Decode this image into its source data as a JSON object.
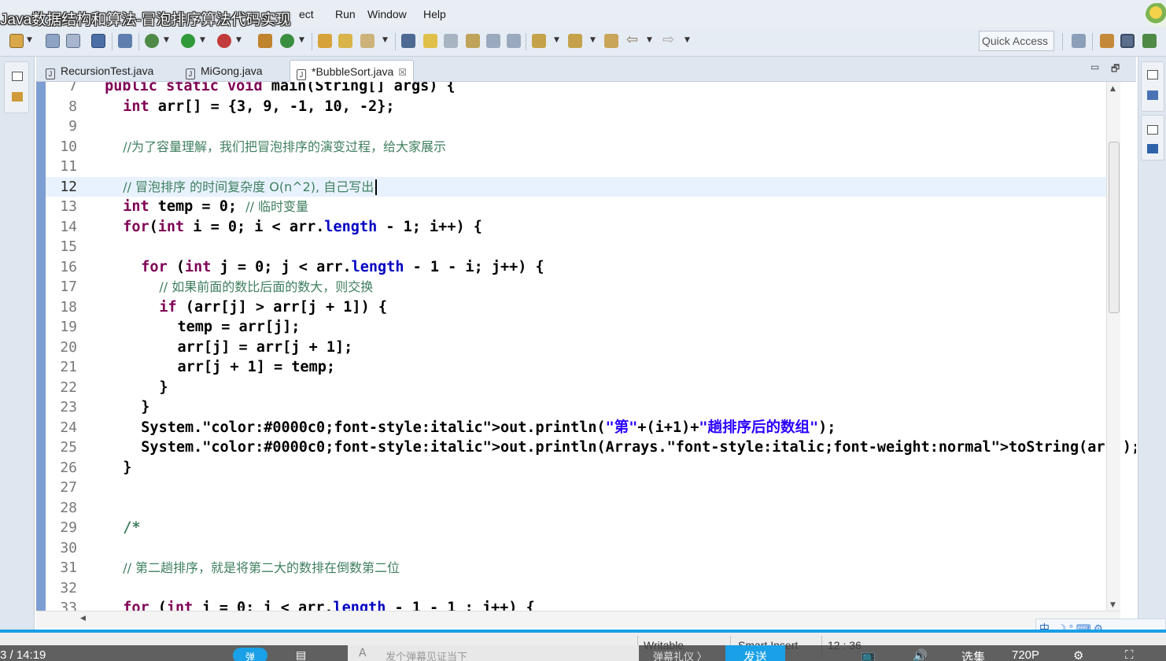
{
  "window": {
    "video_title": "Java数据结构和算法-冒泡排序算法代码实现",
    "menus": [
      "ect",
      "Run",
      "Window",
      "Help"
    ]
  },
  "toolbar": {
    "quick_access": "Quick Access"
  },
  "tabs": [
    {
      "label": "RecursionTest.java",
      "active": false
    },
    {
      "label": "MiGong.java",
      "active": false
    },
    {
      "label": "*BubbleSort.java",
      "active": true,
      "close": "☒"
    }
  ],
  "editor": {
    "current_line": "12",
    "lines": [
      {
        "n": "7",
        "text": "    public static void main(String[] args) {"
      },
      {
        "n": "8",
        "text": "        int arr[] = {3, 9, -1, 10, -2};"
      },
      {
        "n": "9",
        "text": ""
      },
      {
        "n": "10",
        "text": "        //为了容量理解，我们把冒泡排序的演变过程，给大家展示"
      },
      {
        "n": "11",
        "text": ""
      },
      {
        "n": "12",
        "text": "        // 冒泡排序 的时间复杂度 O(n^2), 自己写出"
      },
      {
        "n": "13",
        "text": "        int temp = 0; // 临时变量"
      },
      {
        "n": "14",
        "text": "        for(int i = 0; i < arr.length - 1; i++) {"
      },
      {
        "n": "15",
        "text": ""
      },
      {
        "n": "16",
        "text": "            for (int j = 0; j < arr.length - 1 - i; j++) {"
      },
      {
        "n": "17",
        "text": "                // 如果前面的数比后面的数大，则交换"
      },
      {
        "n": "18",
        "text": "                if (arr[j] > arr[j + 1]) {"
      },
      {
        "n": "19",
        "text": "                    temp = arr[j];"
      },
      {
        "n": "20",
        "text": "                    arr[j] = arr[j + 1];"
      },
      {
        "n": "21",
        "text": "                    arr[j + 1] = temp;"
      },
      {
        "n": "22",
        "text": "                }"
      },
      {
        "n": "23",
        "text": "            }"
      },
      {
        "n": "24",
        "text": "            System.out.println(\"第\"+(i+1)+\"趟排序后的数组\");"
      },
      {
        "n": "25",
        "text": "            System.out.println(Arrays.toString(arr));"
      },
      {
        "n": "26",
        "text": "        }"
      },
      {
        "n": "27",
        "text": ""
      },
      {
        "n": "28",
        "text": ""
      },
      {
        "n": "29",
        "text": "        /*"
      },
      {
        "n": "30",
        "text": ""
      },
      {
        "n": "31",
        "text": "        // 第二趟排序，就是将第二大的数排在倒数第二位"
      },
      {
        "n": "32",
        "text": ""
      },
      {
        "n": "33",
        "text": "        for (int j = 0; j < arr.length - 1 - 1 ; j++) {"
      }
    ]
  },
  "status": {
    "writable": "Writable",
    "insert_mode": "Smart Insert",
    "position": "12 : 36"
  },
  "video": {
    "time": "3 / 14:19",
    "bubble": "弹",
    "placeholder": "发个弹幕见证当下",
    "etiquette": "弹幕礼仪 〉",
    "send": "发送",
    "episodes": "选集",
    "quality": "720P"
  },
  "ime": {
    "label": "中"
  }
}
